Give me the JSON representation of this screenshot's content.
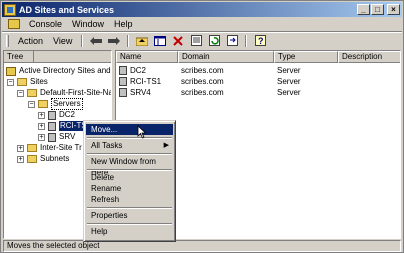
{
  "window": {
    "title": "AD Sites and Services",
    "minimize": "_",
    "maximize": "□",
    "close": "×"
  },
  "menubar": {
    "items": [
      {
        "label": "Console"
      },
      {
        "label": "Window"
      },
      {
        "label": "Help"
      }
    ]
  },
  "toolbar": {
    "action_label": "Action",
    "view_label": "View",
    "icons": [
      "back-arrow-icon",
      "forward-arrow-icon",
      "up-folder-icon",
      "show-tree-icon",
      "delete-icon",
      "properties-icon",
      "refresh-icon",
      "export-icon",
      "help-icon"
    ]
  },
  "tree": {
    "header": "Tree",
    "root": "Active Directory Sites and Se",
    "sites": "Sites",
    "site": "Default-First-Site-Nam",
    "servers": "Servers",
    "dc2": "DC2",
    "rcits1": "RCI-TS1",
    "srv4": "SRV",
    "intersite": "Inter-Site Tr",
    "subnets": "Subnets",
    "expand_plus": "+",
    "expand_minus": "−"
  },
  "list": {
    "columns": [
      "Name",
      "Domain",
      "Type",
      "Description"
    ],
    "rows": [
      {
        "name": "DC2",
        "domain": "scribes.com",
        "type": "Server",
        "description": ""
      },
      {
        "name": "RCI-TS1",
        "domain": "scribes.com",
        "type": "Server",
        "description": ""
      },
      {
        "name": "SRV4",
        "domain": "scribes.com",
        "type": "Server",
        "description": ""
      }
    ]
  },
  "context_menu": {
    "move": "Move...",
    "all_tasks": "All Tasks",
    "all_tasks_arrow": "▶",
    "new_window": "New Window from Here",
    "delete": "Delete",
    "rename": "Rename",
    "refresh": "Refresh",
    "properties": "Properties",
    "help": "Help"
  },
  "statusbar": {
    "text": "Moves the selected object"
  },
  "colors": {
    "title_start": "#0a246a",
    "title_end": "#a6caf0",
    "highlight": "#0a246a",
    "face": "#d4d0c8"
  }
}
